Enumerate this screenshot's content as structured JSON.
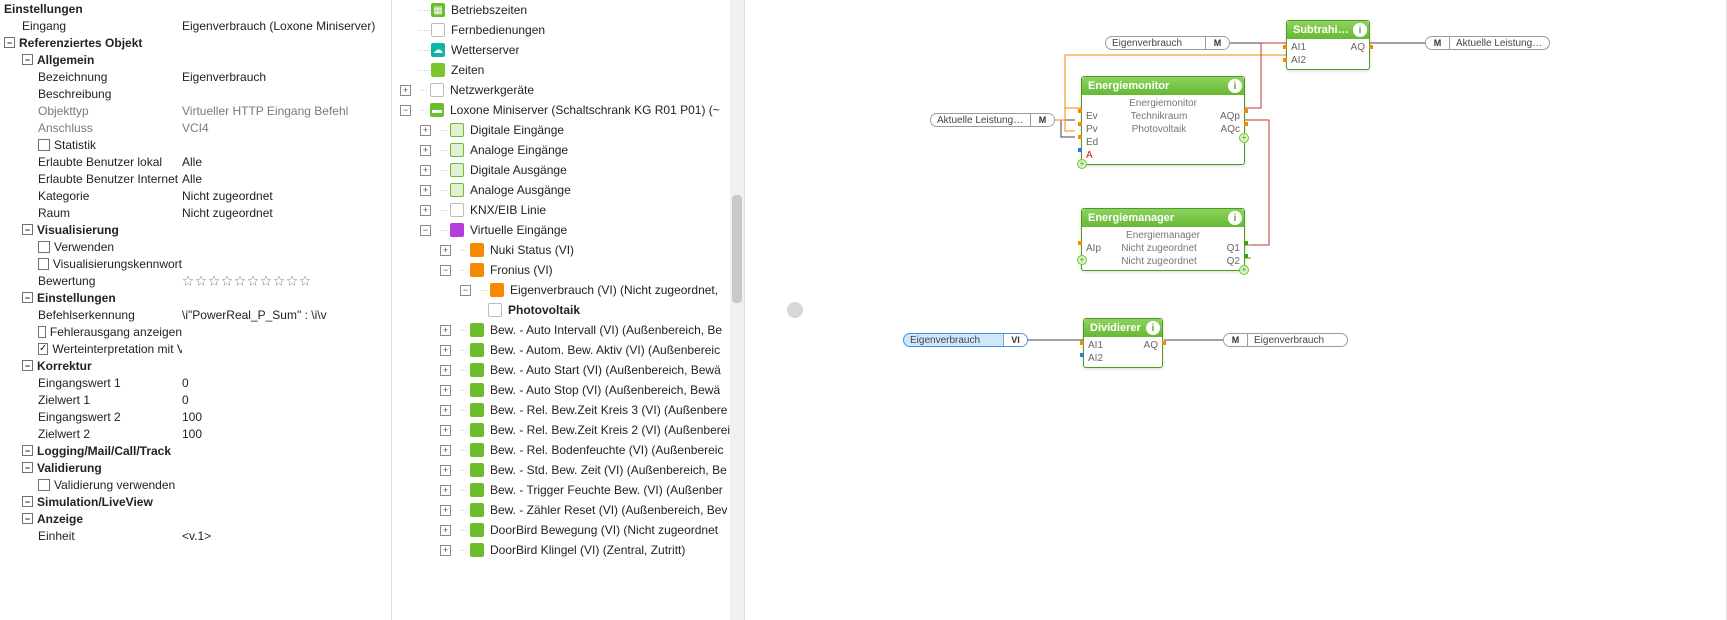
{
  "properties": {
    "p0": "Einstellungen",
    "p1_l": "Eingang",
    "p1_v": "Eigenverbrauch (Loxone Miniserver)",
    "p2": "Referenziertes Objekt",
    "p3": "Allgemein",
    "p4_l": "Bezeichnung",
    "p4_v": "Eigenverbrauch",
    "p5_l": "Beschreibung",
    "p5_v": "",
    "p6_l": "Objekttyp",
    "p6_v": "Virtueller HTTP Eingang Befehl",
    "p7_l": "Anschluss",
    "p7_v": "VCI4",
    "p8": "Statistik",
    "p9_l": "Erlaubte Benutzer lokal",
    "p9_v": "Alle",
    "p10_l": "Erlaubte Benutzer Internet",
    "p10_v": "Alle",
    "p11_l": "Kategorie",
    "p11_v": "Nicht zugeordnet",
    "p12_l": "Raum",
    "p12_v": "Nicht zugeordnet",
    "p13": "Visualisierung",
    "p14": "Verwenden",
    "p15": "Visualisierungskennwort",
    "p16_l": "Bewertung",
    "p17": "Einstellungen",
    "p18_l": "Befehlserkennung",
    "p18_v": "\\i\"PowerReal_P_Sum\" : \\i\\v",
    "p19": "Fehlerausgang anzeigen",
    "p20": "Werteinterpretation mit Vor…",
    "p21": "Korrektur",
    "p22_l": "Eingangswert 1",
    "p22_v": "0",
    "p23_l": "Zielwert 1",
    "p23_v": "0",
    "p24_l": "Eingangswert 2",
    "p24_v": "100",
    "p25_l": "Zielwert 2",
    "p25_v": "100",
    "p26": "Logging/Mail/Call/Track",
    "p27": "Validierung",
    "p28": "Validierung verwenden",
    "p29": "Simulation/LiveView",
    "p30": "Anzeige",
    "p31_l": "Einheit",
    "p31_v": "<v.1>"
  },
  "tree": {
    "t0": "Betriebszeiten",
    "t1": "Fernbedienungen",
    "t2": "Wetterserver",
    "t3": "Zeiten",
    "t4": "Netzwerkgeräte",
    "t5": "Loxone Miniserver (Schaltschrank KG R01 P01) (~",
    "t6": "Digitale Eingänge",
    "t7": "Analoge Eingänge",
    "t8": "Digitale Ausgänge",
    "t9": "Analoge Ausgänge",
    "t10": "KNX/EIB Linie",
    "t11": "Virtuelle Eingänge",
    "t12": "Nuki Status (VI)",
    "t13": "Fronius (VI)",
    "t14": "Eigenverbrauch (VI) (Nicht zugeordnet,",
    "t15": "Photovoltaik",
    "t16": "Bew. - Auto Intervall (VI) (Außenbereich, Be",
    "t17": "Bew. - Autom. Bew. Aktiv (VI) (Außenbereic",
    "t18": "Bew. - Auto Start (VI) (Außenbereich, Bewä",
    "t19": "Bew. - Auto Stop (VI) (Außenbereich, Bewä",
    "t20": "Bew. - Rel. Bew.Zeit Kreis 3 (VI) (Außenbere",
    "t21": "Bew. - Rel. Bew.Zeit Kreis 2 (VI) (Außenberei",
    "t22": "Bew. - Rel. Bodenfeuchte (VI) (Außenbereic",
    "t23": "Bew. - Std. Bew. Zeit (VI) (Außenbereich, Be",
    "t24": "Bew. - Trigger Feuchte Bew. (VI) (Außenber",
    "t25": "Bew. - Zähler Reset (VI) (Außenbereich, Bev",
    "t26": "DoorBird Bewegung (VI) (Nicht zugeordnet",
    "t27": "DoorBird Klingel (VI) (Zentral, Zutritt)"
  },
  "canvas": {
    "pill_eigen1": "Eigenverbrauch",
    "cap_m": "M",
    "pill_aktuelle1": "Aktuelle Leistung Netz",
    "pill_aktuelle2": "Aktuelle Leistung Netz",
    "pill_eigen2": "Eigenverbrauch",
    "cap_vi": "VI",
    "pill_eigen3": "Eigenverbrauch",
    "block_sub": "Subtrahi…",
    "sub_ai1": "AI1",
    "sub_ai2": "AI2",
    "sub_aq": "AQ",
    "block_em": "Energiemonitor",
    "em_sub": "Energiemonitor",
    "em_ev": "Ev",
    "em_ev_c": "Technikraum",
    "em_aqp": "AQp",
    "em_pv": "Pv",
    "em_pv_c": "Photovoltaik",
    "em_aqc": "AQc",
    "em_ed": "Ed",
    "em_a": "A",
    "block_mgr": "Energiemanager",
    "mgr_sub": "Energiemanager",
    "mgr_alp": "AIp",
    "mgr_alp_c": "Nicht zugeordnet",
    "mgr_q1": "Q1",
    "mgr_row2_c": "Nicht zugeordnet",
    "mgr_q2": "Q2",
    "block_div": "Dividierer",
    "div_ai1": "AI1",
    "div_ai2": "AI2",
    "div_aq": "AQ"
  }
}
